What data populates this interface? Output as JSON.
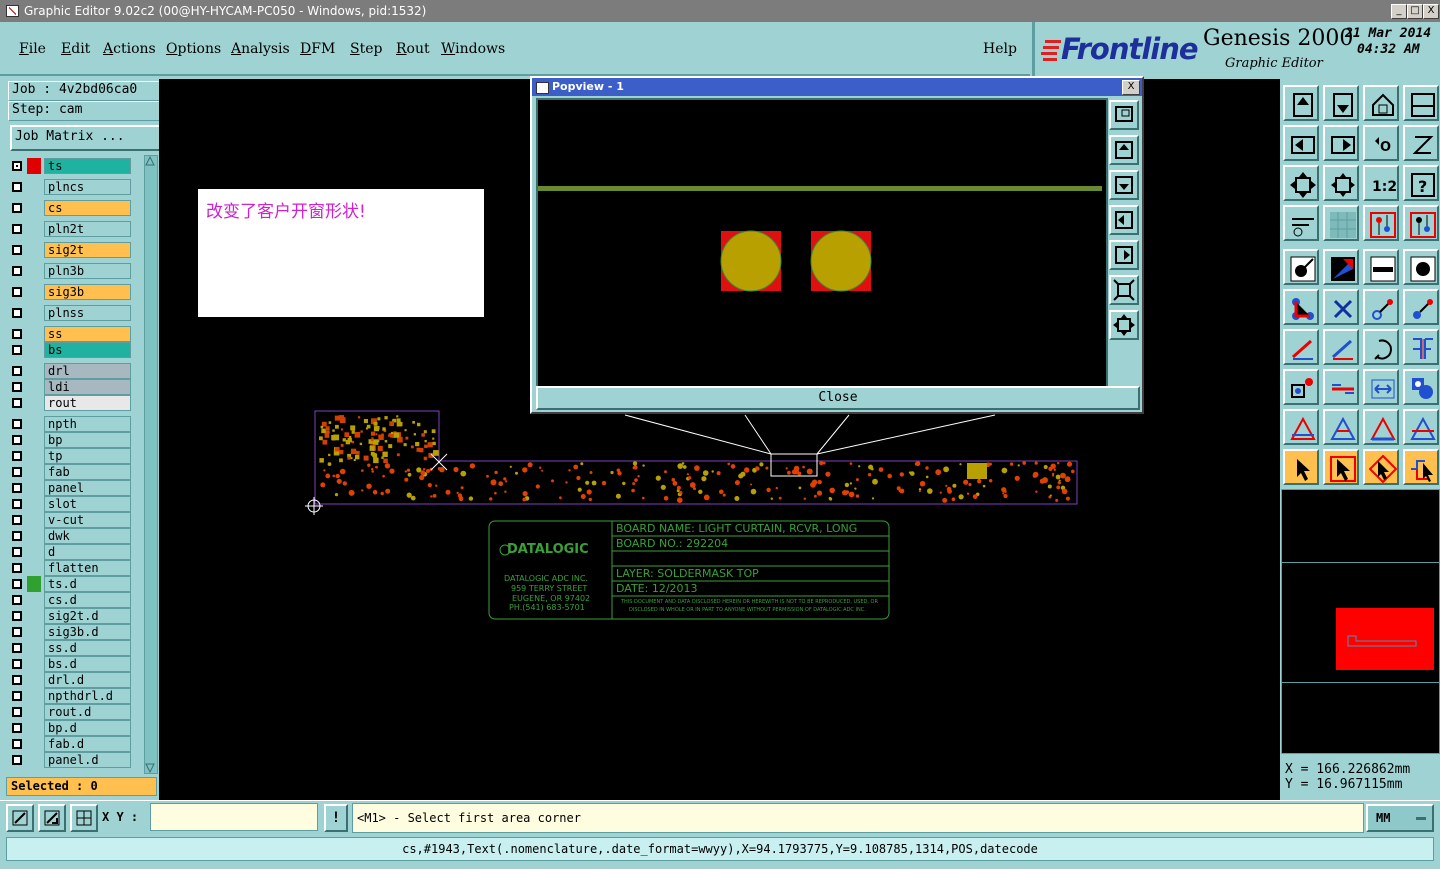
{
  "window": {
    "title": "Graphic Editor 9.02c2 (00@HY-HYCAM-PC050 - Windows, pid:1532)",
    "minimize": "_",
    "maximize": "□",
    "close": "X"
  },
  "menu": {
    "items": [
      {
        "u": "F",
        "rest": "ile"
      },
      {
        "u": "E",
        "rest": "dit"
      },
      {
        "u": "A",
        "rest": "ctions"
      },
      {
        "u": "O",
        "rest": "ptions"
      },
      {
        "u": "A",
        "rest": "nalysis"
      },
      {
        "u": "D",
        "rest": "FM"
      },
      {
        "u": "S",
        "rest": "tep"
      },
      {
        "u": "R",
        "rest": "out"
      },
      {
        "u": "W",
        "rest": "indows"
      }
    ],
    "help": "Help"
  },
  "brand": {
    "logo": "Frontline",
    "product": "Genesis 2000",
    "subtitle": "Graphic Editor",
    "date": "21 Mar 2014",
    "time": "04:32 AM"
  },
  "job": {
    "job_line": "Job : 4v2bd06ca0",
    "step_line": "Step: cam",
    "matrix_button": "Job Matrix ..."
  },
  "layers": [
    {
      "name": "ts",
      "color": "#20b2a0",
      "mark": "#e00000",
      "checked": true
    },
    {
      "name": "plncs",
      "color": "#9fd3d3"
    },
    {
      "name": "cs",
      "color": "#ffc050"
    },
    {
      "name": "pln2t",
      "color": "#9fd3d3"
    },
    {
      "name": "sig2t",
      "color": "#ffc050"
    },
    {
      "name": "pln3b",
      "color": "#9fd3d3"
    },
    {
      "name": "sig3b",
      "color": "#ffc050"
    },
    {
      "name": "plnss",
      "color": "#9fd3d3"
    },
    {
      "name": "ss",
      "color": "#ffc050"
    },
    {
      "name": "bs",
      "color": "#20b2a0"
    },
    {
      "name": "drl",
      "color": "#a8b8c0"
    },
    {
      "name": "ldi",
      "color": "#a8b8c0"
    },
    {
      "name": "rout",
      "color": "#e8e8e8"
    },
    {
      "name": "npth",
      "color": "#9fd3d3"
    },
    {
      "name": "bp",
      "color": "#9fd3d3"
    },
    {
      "name": "tp",
      "color": "#9fd3d3"
    },
    {
      "name": "fab",
      "color": "#9fd3d3"
    },
    {
      "name": "panel",
      "color": "#9fd3d3"
    },
    {
      "name": "slot",
      "color": "#9fd3d3"
    },
    {
      "name": "v-cut",
      "color": "#9fd3d3"
    },
    {
      "name": "dwk",
      "color": "#9fd3d3"
    },
    {
      "name": "d",
      "color": "#9fd3d3"
    },
    {
      "name": "flatten",
      "color": "#9fd3d3"
    },
    {
      "name": "ts.d",
      "color": "#9fd3d3",
      "mark": "#30a030"
    },
    {
      "name": "cs.d",
      "color": "#9fd3d3"
    },
    {
      "name": "sig2t.d",
      "color": "#9fd3d3"
    },
    {
      "name": "sig3b.d",
      "color": "#9fd3d3"
    },
    {
      "name": "ss.d",
      "color": "#9fd3d3"
    },
    {
      "name": "bs.d",
      "color": "#9fd3d3"
    },
    {
      "name": "drl.d",
      "color": "#9fd3d3"
    },
    {
      "name": "npthdrl.d",
      "color": "#9fd3d3"
    },
    {
      "name": "rout.d",
      "color": "#9fd3d3"
    },
    {
      "name": "bp.d",
      "color": "#9fd3d3"
    },
    {
      "name": "fab.d",
      "color": "#9fd3d3"
    },
    {
      "name": "panel.d",
      "color": "#9fd3d3"
    }
  ],
  "selected": "Selected : 0",
  "note": "改变了客户开窗形状!",
  "popview": {
    "title": "Popview - 1",
    "close_x": "X",
    "close_button": "Close"
  },
  "titleblock": {
    "company": "DATALOGIC",
    "address": [
      "DATALOGIC ADC INC.",
      "959 TERRY STREET",
      "EUGENE, OR 97402",
      "PH.(541) 683-5701"
    ],
    "board_name": "BOARD NAME: LIGHT CURTAIN, RCVR, LONG",
    "board_no": "BOARD NO.: 292204",
    "layer": "LAYER:  SOLDERMASK TOP",
    "date": "DATE: 12/2013",
    "disclaimer1": "THIS DOCUMENT AND DATA DISCLOSED HEREIN OR HEREWITH IS NOT TO BE REPRODUCED, USED, OR",
    "disclaimer2": "DISCLOSED IN WHOLE OR IN PART TO ANYONE WITHOUT PERMISSION OF DATALOGIC ADC INC."
  },
  "coords": {
    "x": "X  =  166.226862mm",
    "y": "Y  =  16.967115mm"
  },
  "bottom": {
    "xy_label": "X Y :",
    "xy_value": "",
    "bang": "!",
    "prompt": "<M1> - Select first area corner",
    "units": "MM"
  },
  "status": "cs,#1943,Text(.nomenclature,.date_format=wwyy),X=94.1793775,Y=9.108785,1314,POS,datecode",
  "icons": {
    "toolbar": [
      "zoom-home-icon",
      "zoom-out-icon",
      "fit-icon",
      "zoom-window-icon",
      "pan-left-icon",
      "pan-right-icon",
      "redraw-icon",
      "snap-icon",
      "fit-all-icon",
      "center-icon",
      "scale-icon",
      "help-icon",
      "measure-icon",
      "grid-icon",
      "layer-display-icon",
      "layer-display2-icon",
      "feature-select-icon",
      "delete-feature-icon",
      "ruler-icon",
      "pad-icon",
      "connect-icon",
      "cross-icon",
      "line-icon",
      "arc-line-icon",
      "slash-red-icon",
      "slash-blue-icon",
      "arc-icon",
      "pin-icon",
      "move-icon",
      "split-icon",
      "resize-icon",
      "shapes-icon",
      "tri-red-icon",
      "tri-blue-icon",
      "tri-red2-icon",
      "tri-blue2-icon",
      "pointer-icon",
      "pointer-box-icon",
      "pointer-diamond-icon",
      "pointer-route-icon"
    ]
  }
}
